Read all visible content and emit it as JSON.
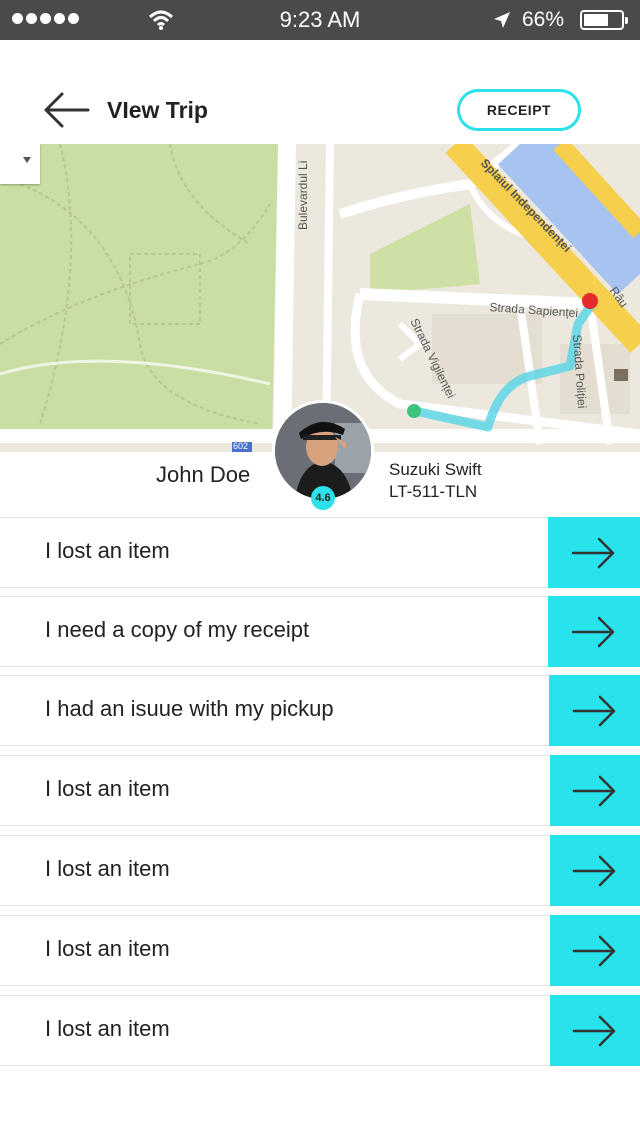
{
  "status_bar": {
    "time": "9:23 AM",
    "battery": "66%"
  },
  "header": {
    "title": "VIew Trip",
    "receipt_label": "RECEIPT"
  },
  "map": {
    "labels": {
      "bulevardul": "Bulevardul Li",
      "splaiul": "Splaiul Independenței",
      "sapienta": "Strada Sapienței",
      "vigilentei": "Strada Vigilenței",
      "politiei": "Strada Poliției",
      "rau": "Râu",
      "route_num": "602"
    }
  },
  "driver": {
    "name": "John Doe",
    "rating": "4.6",
    "car_model": "Suzuki Swift",
    "plate": "LT-511-TLN"
  },
  "issues": [
    {
      "label": "I lost an item"
    },
    {
      "label": "I need a copy of my receipt"
    },
    {
      "label": "I had an isuue with my pickup"
    },
    {
      "label": "I lost an item"
    },
    {
      "label": "I lost an item"
    },
    {
      "label": "I lost an item"
    },
    {
      "label": "I lost an item"
    }
  ],
  "colors": {
    "accent": "#27e3ec",
    "status_bar": "#4a4a4a",
    "park": "#c9dea3",
    "river": "#a7c4f0",
    "road_major": "#f6cf4d"
  }
}
